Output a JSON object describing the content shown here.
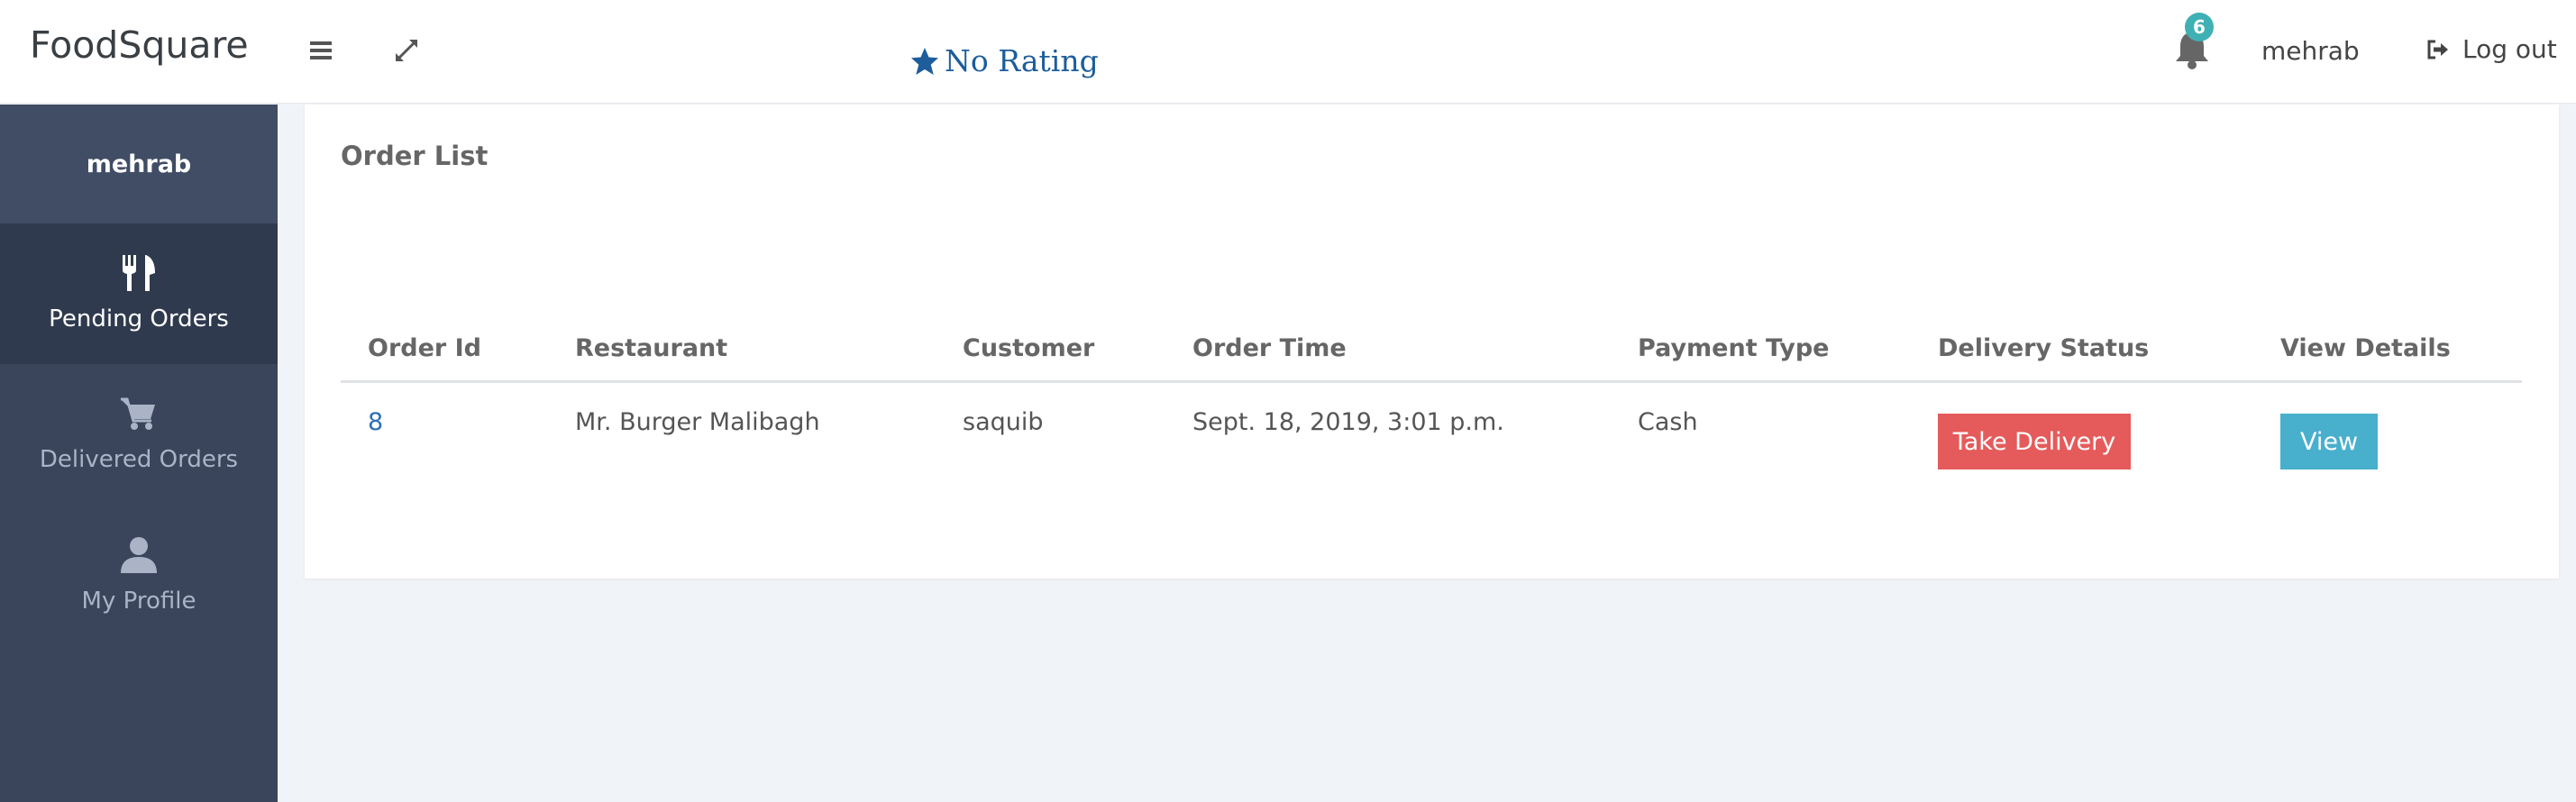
{
  "header": {
    "brand": "FoodSquare",
    "rating_text": "No Rating",
    "notification_count": "6",
    "username": "mehrab",
    "logout_label": "Log out"
  },
  "sidebar": {
    "username": "mehrab",
    "items": [
      {
        "label": "Pending Orders",
        "icon": "cutlery-icon",
        "active": true
      },
      {
        "label": "Delivered Orders",
        "icon": "cart-icon",
        "active": false
      },
      {
        "label": "My Profile",
        "icon": "user-icon",
        "active": false
      }
    ]
  },
  "main": {
    "title": "Order List",
    "table": {
      "columns": [
        "Order Id",
        "Restaurant",
        "Customer",
        "Order Time",
        "Payment Type",
        "Delivery Status",
        "View Details"
      ],
      "rows": [
        {
          "order_id": "8",
          "restaurant": "Mr. Burger Malibagh",
          "customer": "saquib",
          "order_time": "Sept. 18, 2019, 3:01 p.m.",
          "payment_type": "Cash",
          "delivery_action": "Take Delivery",
          "view_action": "View"
        }
      ]
    }
  },
  "colors": {
    "sidebar_bg": "#3a455c",
    "active_item_bg": "#2f3a4e",
    "take_delivery_button": "#e55b5b",
    "view_button": "#48afcd",
    "badge": "#3fb1b4",
    "rating_text": "#1d5d9b"
  }
}
